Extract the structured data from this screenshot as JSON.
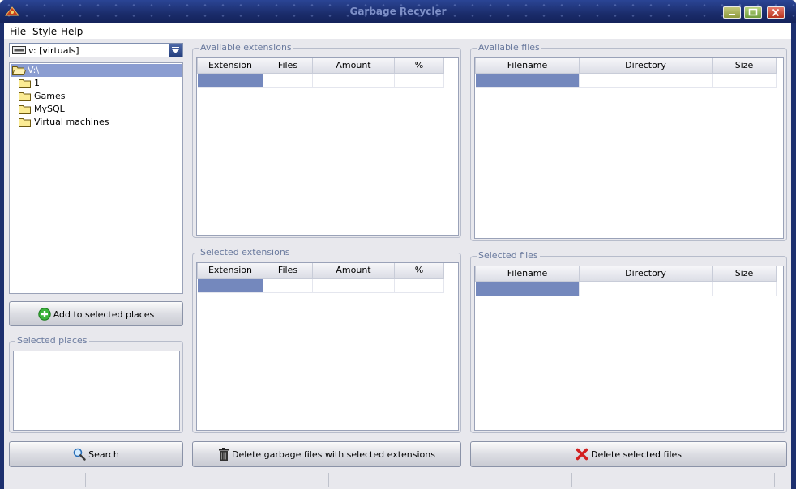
{
  "window": {
    "title": "Garbage Recycler"
  },
  "menu": {
    "file": "File",
    "style": "Style",
    "help": "Help"
  },
  "drive_combo": {
    "value": "v: [virtuals]"
  },
  "tree": {
    "root": "V:\\",
    "folders": [
      "1",
      "Games",
      "MySQL",
      "Virtual machines"
    ]
  },
  "buttons": {
    "add_places": "Add to selected places",
    "search": "Search",
    "delete_garbage": "Delete garbage files with selected extensions",
    "delete_files": "Delete selected files"
  },
  "groups": {
    "selected_places": "Selected places",
    "available_extensions": "Available extensions",
    "selected_extensions": "Selected extensions",
    "available_files": "Available files",
    "selected_files": "Selected files"
  },
  "ext_columns": [
    "Extension",
    "Files",
    "Amount",
    "%"
  ],
  "file_columns": [
    "Filename",
    "Directory",
    "Size"
  ],
  "colors": {
    "title_bar": "#1c2f6e",
    "selection": "#7488bd",
    "face": "#e8e8ed"
  }
}
